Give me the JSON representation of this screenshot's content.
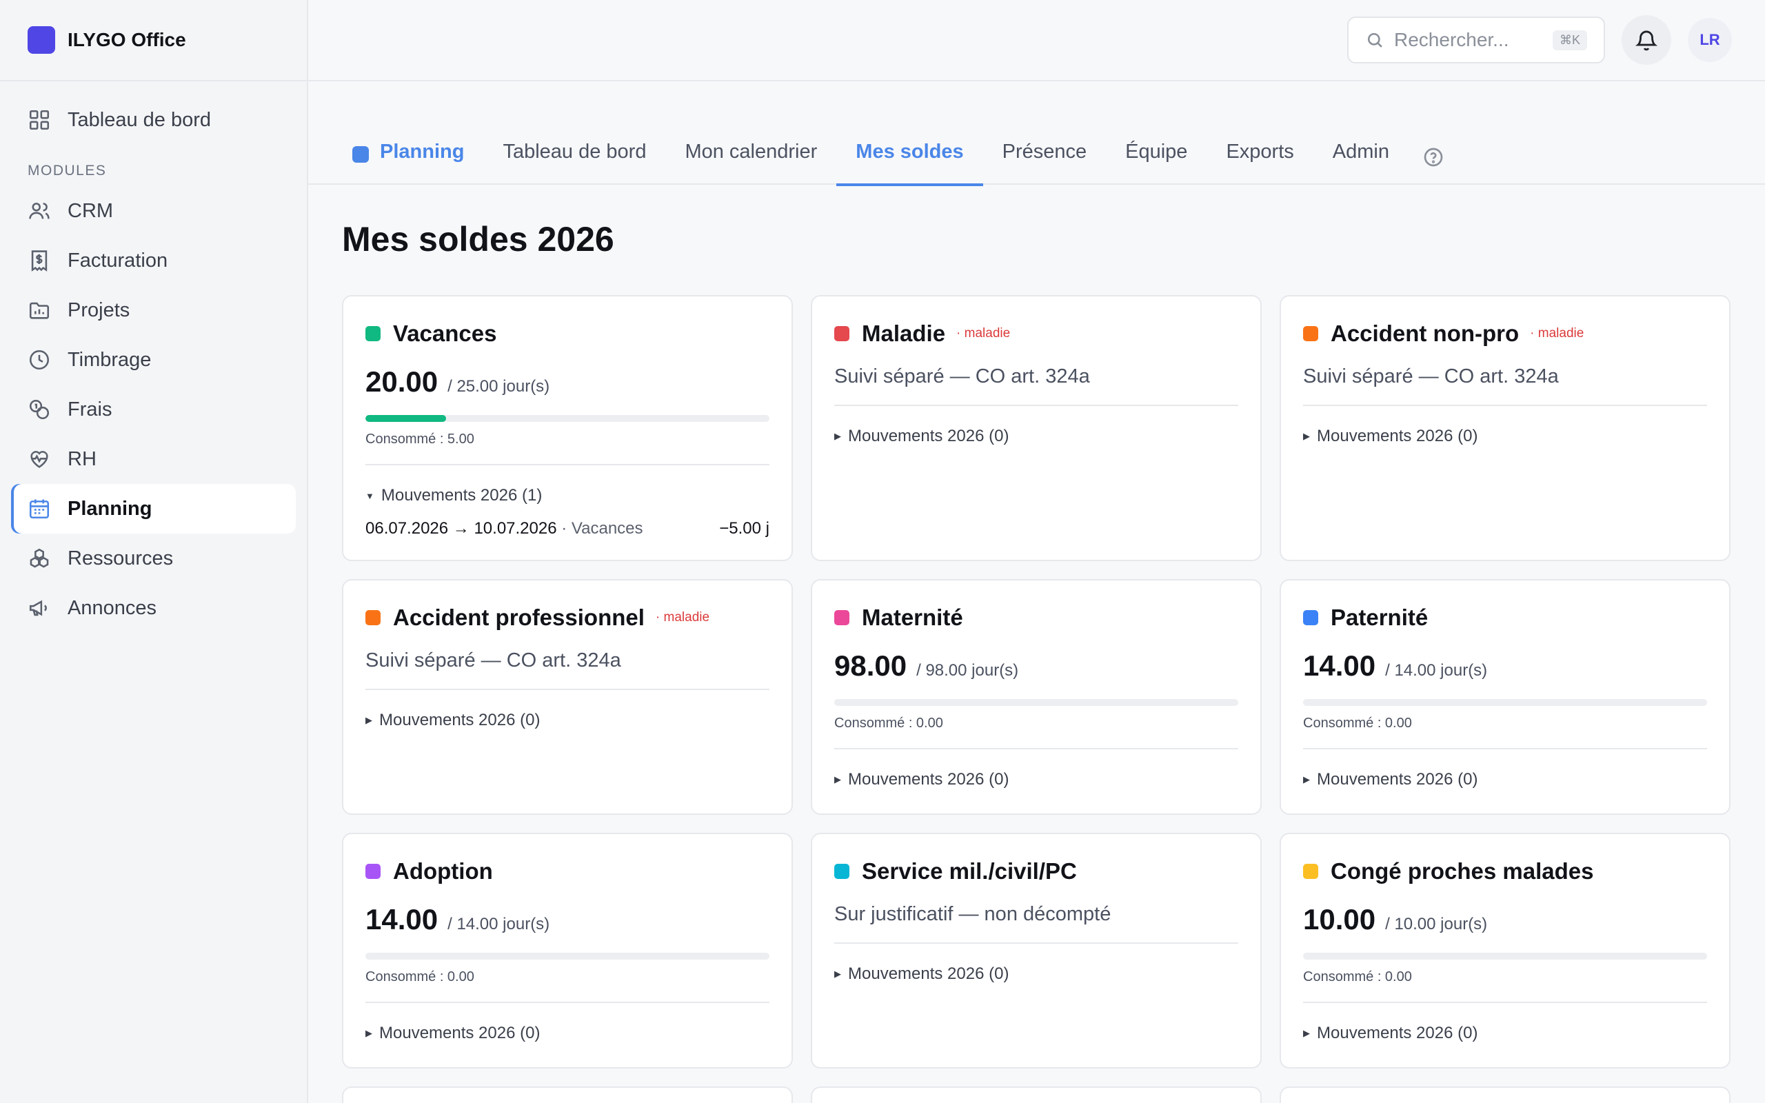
{
  "app": {
    "name": "ILYGO Office"
  },
  "sidebar": {
    "top_item": "Tableau de bord",
    "section_label": "MODULES",
    "items": [
      {
        "label": "CRM",
        "icon": "users-icon"
      },
      {
        "label": "Facturation",
        "icon": "invoice-icon"
      },
      {
        "label": "Projets",
        "icon": "folder-icon"
      },
      {
        "label": "Timbrage",
        "icon": "clock-icon"
      },
      {
        "label": "Frais",
        "icon": "coins-icon"
      },
      {
        "label": "RH",
        "icon": "heart-pulse-icon"
      },
      {
        "label": "Planning",
        "icon": "calendar-icon",
        "active": true
      },
      {
        "label": "Ressources",
        "icon": "boxes-icon"
      },
      {
        "label": "Annonces",
        "icon": "megaphone-icon"
      }
    ]
  },
  "topbar": {
    "search_placeholder": "Rechercher...",
    "search_shortcut": "⌘K",
    "avatar_initials": "LR"
  },
  "tabs": {
    "module": "Planning",
    "items": [
      "Tableau de bord",
      "Mon calendrier",
      "Mes soldes",
      "Présence",
      "Équipe",
      "Exports",
      "Admin"
    ],
    "active": "Mes soldes"
  },
  "page": {
    "title": "Mes soldes 2026"
  },
  "cards": [
    {
      "title": "Vacances",
      "color": "#10b981",
      "balance": "20.00",
      "total": "/ 25.00 jour(s)",
      "progress": 0.2,
      "consumed": "Consommé : 5.00",
      "movements": "Mouvements 2026 (1)",
      "expanded": true,
      "movement_rows": [
        {
          "dates": "06.07.2026 → 10.07.2026",
          "kind": "· Vacances",
          "amount": "−5.00 j"
        }
      ]
    },
    {
      "title": "Maladie",
      "color": "#e5484d",
      "tag": "· maladie",
      "note": "Suivi séparé — CO art. 324a",
      "movements": "Mouvements 2026 (0)"
    },
    {
      "title": "Accident non-pro",
      "color": "#f97316",
      "tag": "· maladie",
      "note": "Suivi séparé — CO art. 324a",
      "movements": "Mouvements 2026 (0)"
    },
    {
      "title": "Accident professionnel",
      "color": "#f97316",
      "tag": "· maladie",
      "note": "Suivi séparé — CO art. 324a",
      "movements": "Mouvements 2026 (0)"
    },
    {
      "title": "Maternité",
      "color": "#ec4899",
      "balance": "98.00",
      "total": "/ 98.00 jour(s)",
      "progress": 0,
      "consumed": "Consommé : 0.00",
      "movements": "Mouvements 2026 (0)"
    },
    {
      "title": "Paternité",
      "color": "#3b82f6",
      "balance": "14.00",
      "total": "/ 14.00 jour(s)",
      "progress": 0,
      "consumed": "Consommé : 0.00",
      "movements": "Mouvements 2026 (0)"
    },
    {
      "title": "Adoption",
      "color": "#a855f7",
      "balance": "14.00",
      "total": "/ 14.00 jour(s)",
      "progress": 0,
      "consumed": "Consommé : 0.00",
      "movements": "Mouvements 2026 (0)"
    },
    {
      "title": "Service mil./civil/PC",
      "color": "#06b6d4",
      "note": "Sur justificatif — non décompté",
      "movements": "Mouvements 2026 (0)"
    },
    {
      "title": "Congé proches malades",
      "color": "#fbbf24",
      "balance": "10.00",
      "total": "/ 10.00 jour(s)",
      "progress": 0,
      "consumed": "Consommé : 0.00",
      "movements": "Mouvements 2026 (0)"
    }
  ]
}
